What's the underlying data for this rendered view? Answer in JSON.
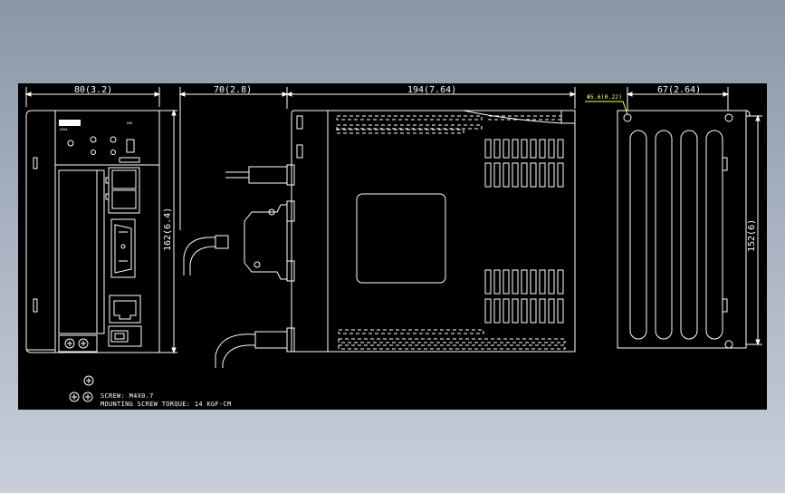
{
  "colors": {
    "background": "#000000",
    "linework": "#ffffff",
    "hole_callout": "#ffff66"
  },
  "dimensions": {
    "front_width": "80(3.2)",
    "front_height": "162(6.4)",
    "connector_depth": "70(2.8)",
    "side_depth": "194(7.64)",
    "rear_width": "67(2.64)",
    "rear_height": "152(6)",
    "hole": "Φ5.6(0.22)"
  },
  "notes": {
    "screw": "SCREW: M4X0.7",
    "torque": "MOUNTING SCREW TORQUE: 14 KGF-CM"
  }
}
